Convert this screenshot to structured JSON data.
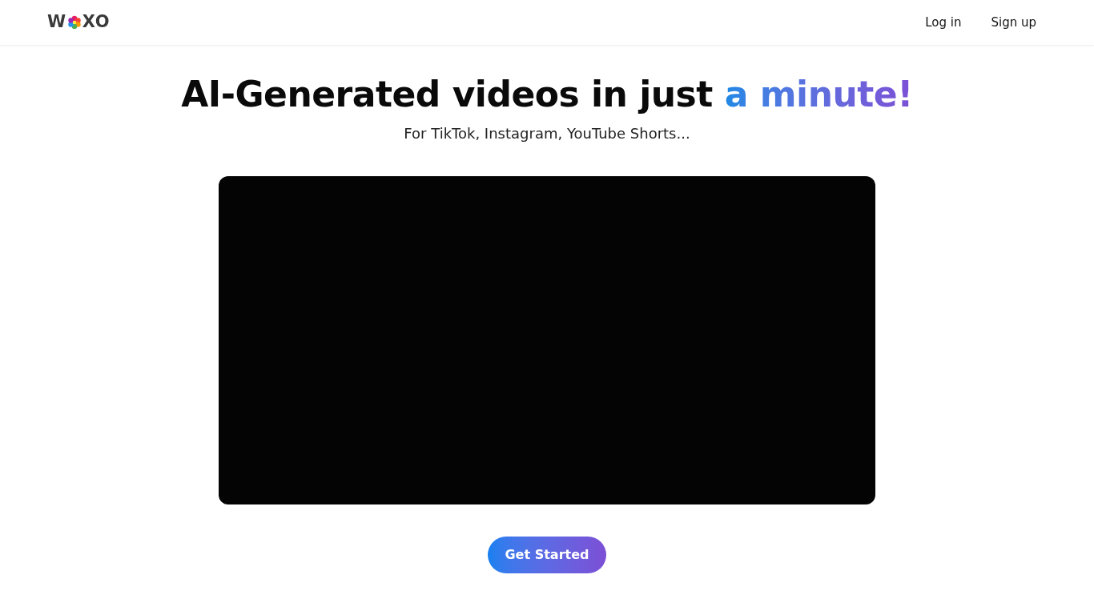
{
  "header": {
    "logo": {
      "left": "W",
      "right": "XO"
    },
    "nav": [
      {
        "label": "Log in"
      },
      {
        "label": "Sign up"
      }
    ]
  },
  "hero": {
    "title": "AI-Generated videos in just",
    "title_highlight": "a minute!",
    "subtitle": "For TikTok, Instagram, YouTube Shorts...",
    "cta": "Get Started"
  }
}
